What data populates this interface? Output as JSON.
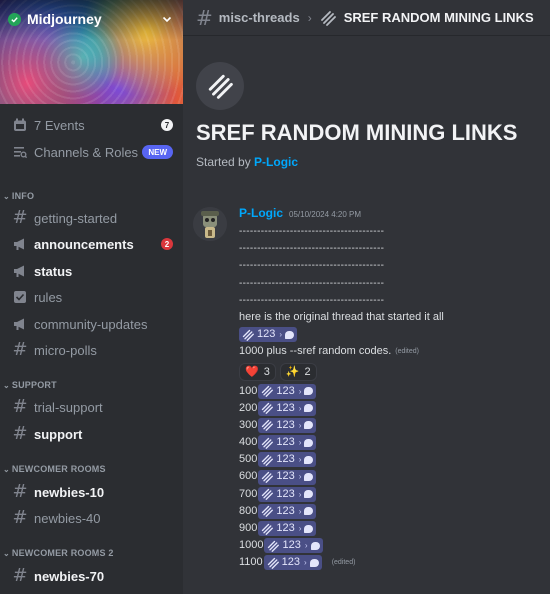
{
  "server": {
    "name": "Midjourney"
  },
  "sidebar": {
    "events": {
      "label": "7 Events",
      "count": "7"
    },
    "channels_roles": {
      "label": "Channels & Roles",
      "badge": "NEW"
    },
    "categories": [
      {
        "label": "INFO"
      },
      {
        "label": "SUPPORT"
      },
      {
        "label": "NEWCOMER ROOMS"
      },
      {
        "label": "NEWCOMER ROOMS 2"
      }
    ],
    "channels": [
      {
        "label": "getting-started"
      },
      {
        "label": "announcements",
        "badge": "2"
      },
      {
        "label": "status"
      },
      {
        "label": "rules"
      },
      {
        "label": "community-updates"
      },
      {
        "label": "micro-polls"
      },
      {
        "label": "trial-support"
      },
      {
        "label": "support"
      },
      {
        "label": "newbies-10"
      },
      {
        "label": "newbies-40"
      },
      {
        "label": "newbies-70"
      }
    ]
  },
  "header": {
    "channel": "misc-threads",
    "thread": "SREF RANDOM MINING LINKS"
  },
  "thread": {
    "title": "SREF RANDOM MINING LINKS",
    "started_prefix": "Started by",
    "started_user": "P-Logic"
  },
  "message": {
    "author": "P-Logic",
    "timestamp": "05/10/2024 4:20 PM",
    "dash_lines": [
      "----------------------------------------",
      "----------------------------------------",
      "----------------------------------------",
      "----------------------------------------",
      "----------------------------------------"
    ],
    "intro": "here is the original thread that started it all",
    "chip_label": "123",
    "desc": "1000 plus --sref random codes.",
    "edited": "(edited)",
    "reactions": [
      {
        "emoji": "❤️",
        "count": "3"
      },
      {
        "emoji": "✨",
        "count": "2"
      }
    ],
    "links": [
      {
        "prefix": "100"
      },
      {
        "prefix": "200"
      },
      {
        "prefix": "300"
      },
      {
        "prefix": "400"
      },
      {
        "prefix": "500"
      },
      {
        "prefix": "600"
      },
      {
        "prefix": "700"
      },
      {
        "prefix": "800"
      },
      {
        "prefix": "900"
      },
      {
        "prefix": "1000"
      },
      {
        "prefix": "1100"
      }
    ],
    "last_edited": "(edited)"
  },
  "colors": {
    "link": "#00a8fc",
    "chip": "#4a4f86",
    "mention_red": "#da373c",
    "blurple": "#5865f2"
  },
  "icons": [
    "calendar-icon",
    "channels-roles-icon",
    "hash-icon",
    "megaphone-icon",
    "rules-icon",
    "thread-icon",
    "bubble-icon",
    "chevron-down-icon",
    "verified-icon"
  ]
}
